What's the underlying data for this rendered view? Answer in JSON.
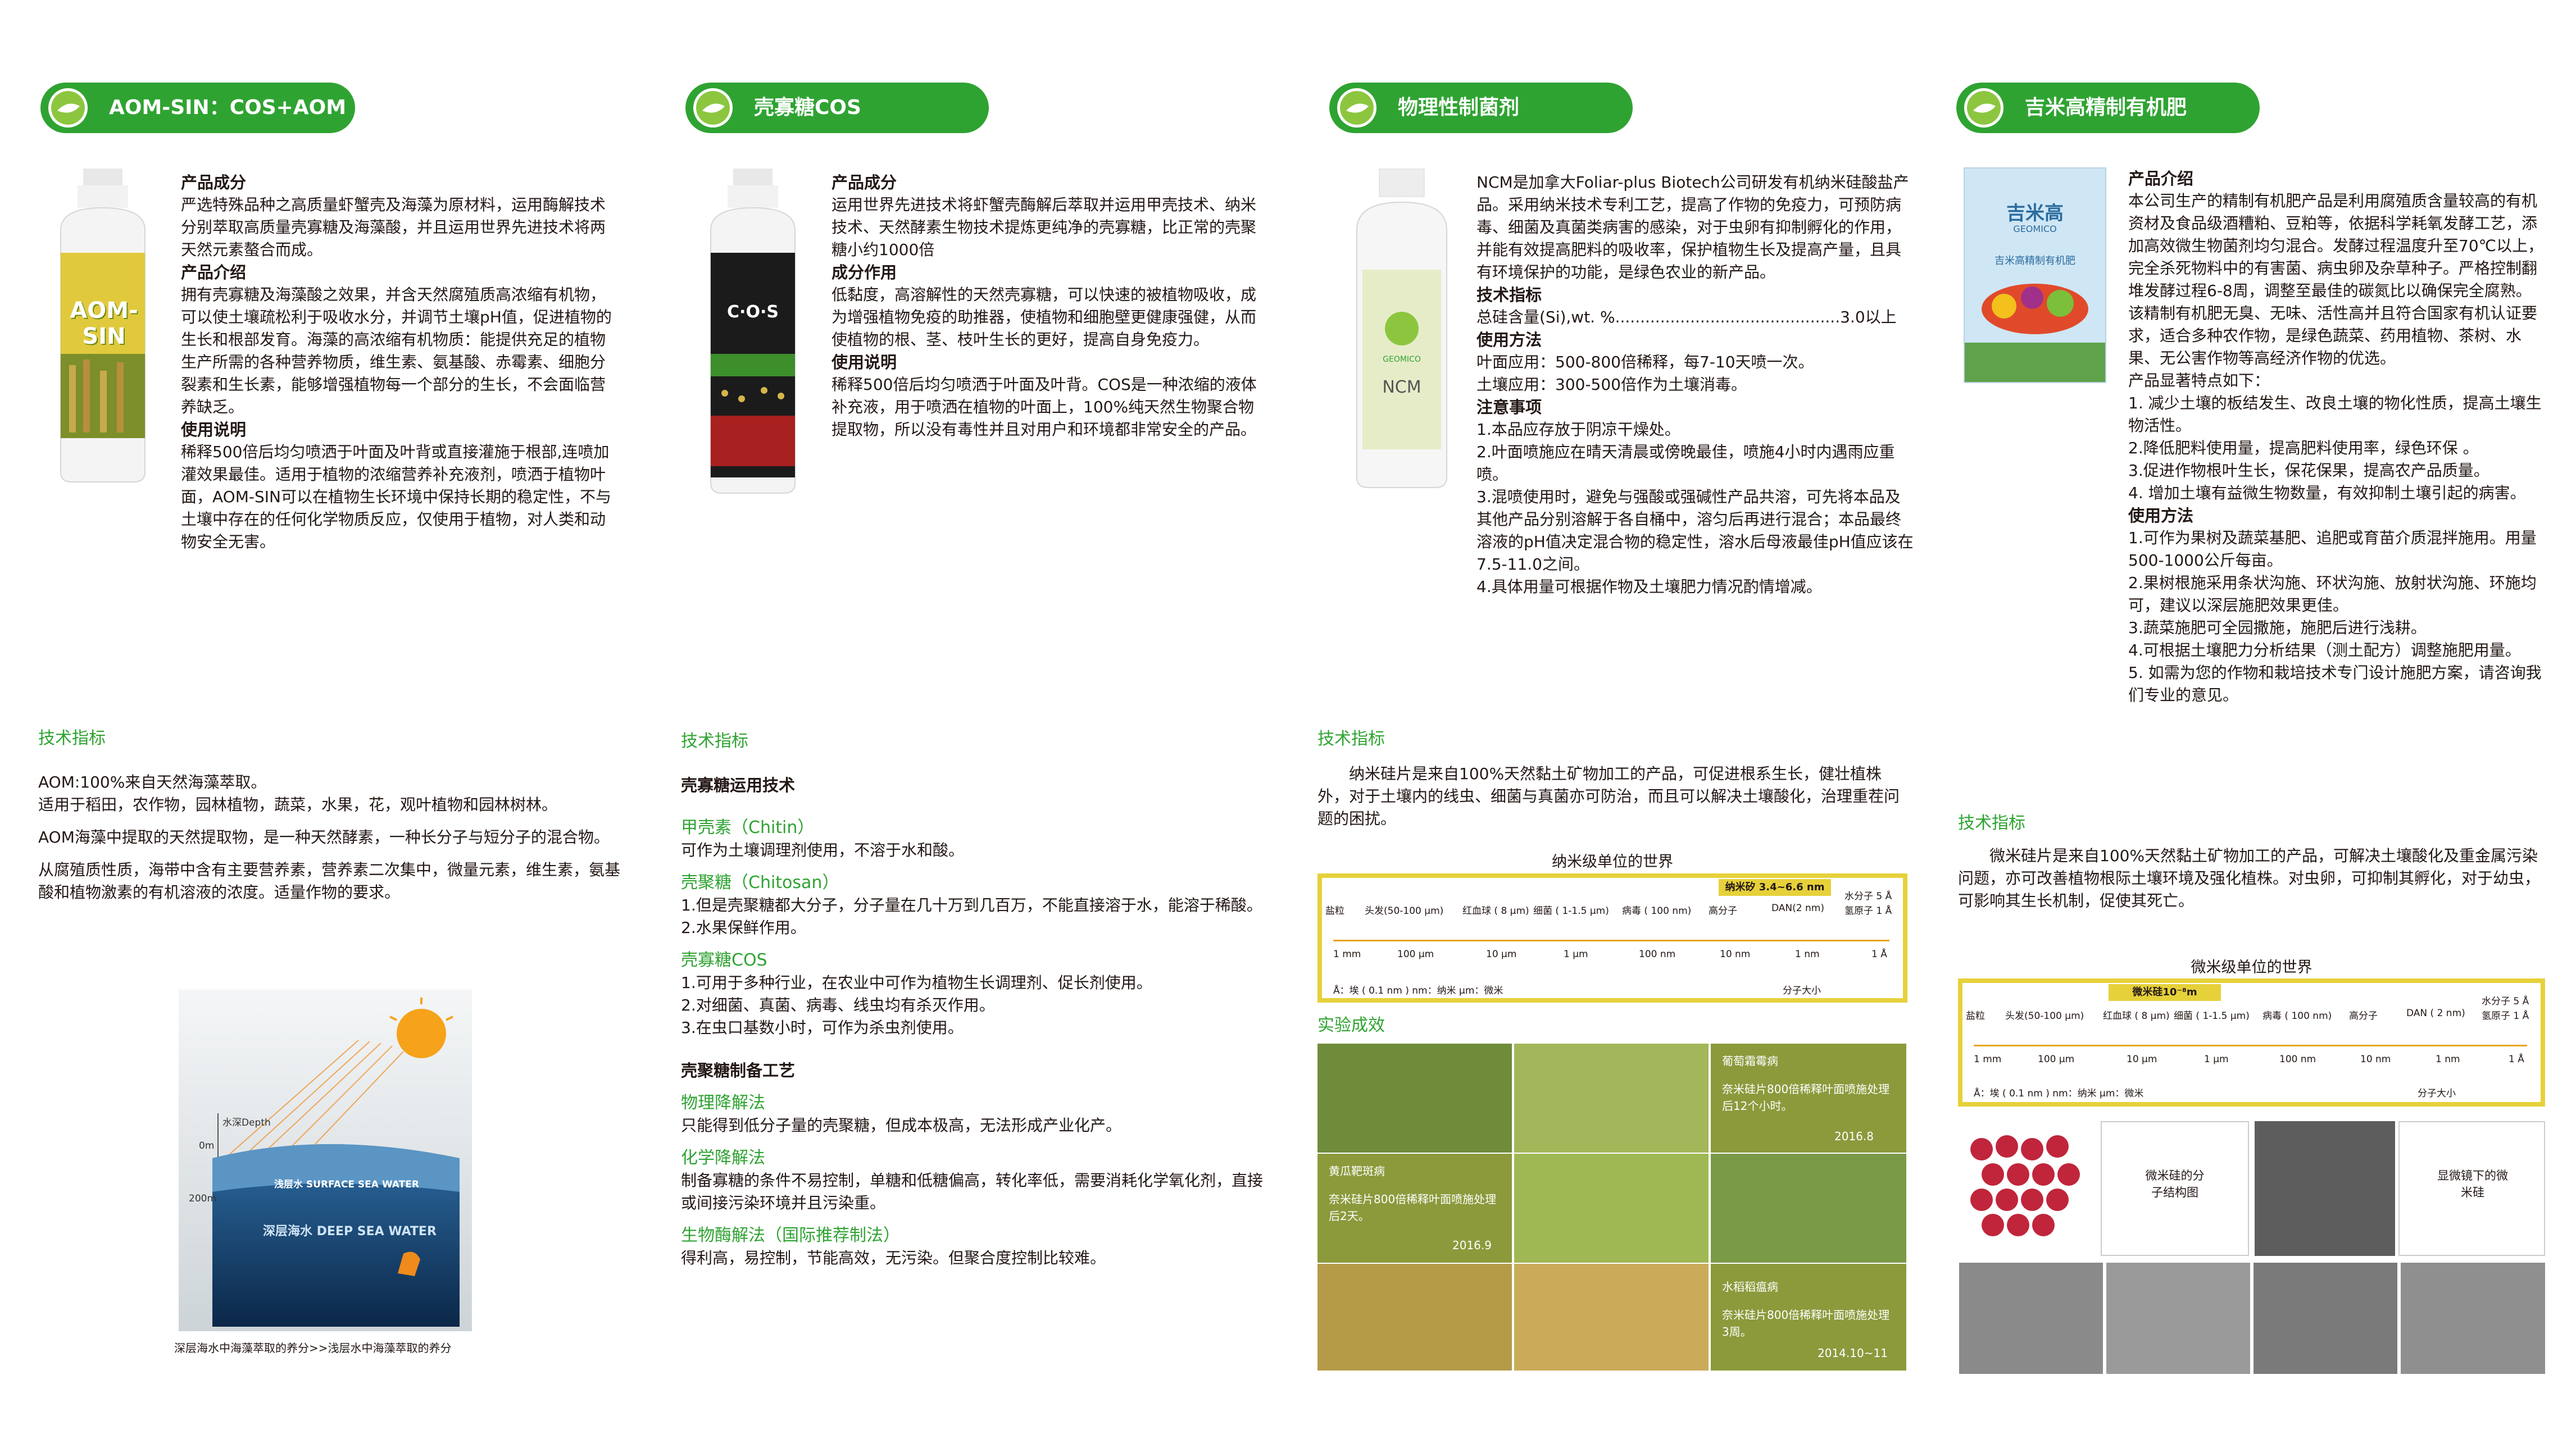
{
  "col1": {
    "pill": "AOM-SIN：COS+AOM",
    "bottle_label": "AOM-SIN",
    "h1": "产品成分",
    "p1": "严选特殊品种之高质量虾蟹壳及海藻为原材料，运用酶解技术分别萃取高质量壳寡糖及海藻酸，并且运用世界先进技术将两天然元素螯合而成。",
    "h2": "产品介绍",
    "p2": "拥有壳寡糖及海藻酸之效果，并含天然腐殖质高浓缩有机物，可以使土壤疏松利于吸收水分，并调节土壤pH值，促进植物的生长和根部发育。海藻的高浓缩有机物质：能提供充足的植物生产所需的各种营养物质，维生素、氨基酸、赤霉素、细胞分裂素和生长素，能够增强植物每一个部分的生长，不会面临营养缺乏。",
    "h3": "使用说明",
    "p3": "稀释500倍后均匀喷洒于叶面及叶背或直接灌施于根部,连喷加灌效果最佳。适用于植物的浓缩营养补充液剂，喷洒于植物叶面，AOM-SIN可以在植物生长环境中保持长期的稳定性，不与土壤中存在的任何化学物质反应，仅使用于植物，对人类和动物安全无害。",
    "spec_title": "技术指标",
    "s1": "AOM:100%来自天然海藻萃取。",
    "s2": "适用于稻田，农作物，园林植物，蔬菜，水果，花，观叶植物和园林树林。",
    "s3": "AOM海藻中提取的天然提取物，是一种天然酵素，一种长分子与短分子的混合物。",
    "s4": "从腐殖质性质，海带中含有主要营养素，营养素二次集中，微量元素，维生素，氨基酸和植物激素的有机溶液的浓度。适量作物的要求。",
    "ocean_depth": "水深Depth",
    "ocean_0m": "0m",
    "ocean_200m": "200m",
    "ocean_shallow": "浅层水  SURFACE SEA WATER",
    "ocean_deep": "深层海水  DEEP SEA WATER",
    "ocean_caption": "深层海水中海藻萃取的养分>>浅层水中海藻萃取的养分"
  },
  "col2": {
    "pill": "壳寡糖COS",
    "bottle_label": "C·O·S",
    "h1": "产品成分",
    "p1": "运用世界先进技术将虾蟹壳酶解后萃取并运用甲壳技术、纳米技术、天然酵素生物技术提炼更纯净的壳寡糖，比正常的壳聚糖小约1000倍",
    "h2": "成分作用",
    "p2": "低黏度，高溶解性的天然壳寡糖，可以快速的被植物吸收，成为增强植物免疫的助推器，使植物和细胞壁更健康强健，从而使植物的根、茎、枝叶生长的更好，提高自身免疫力。",
    "h3": "使用说明",
    "p3": "稀释500倍后均匀喷洒于叶面及叶背。COS是一种浓缩的液体补充液，用于喷洒在植物的叶面上，100%纯天然生物聚合物提取物，所以没有毒性并且对用户和环境都非常安全的产品。",
    "spec_title": "技术指标",
    "b1": "壳寡糖运用技术",
    "g1": "甲壳素（Chitin）",
    "t1": "可作为土壤调理剂使用，不溶于水和酸。",
    "g2": "壳聚糖（Chitosan）",
    "t2": "1.但是壳聚糖都大分子，分子量在几十万到几百万，不能直接溶于水，能溶于稀酸。",
    "t3": "2.水果保鲜作用。",
    "g3": "壳寡糖COS",
    "t4": "1.可用于多种行业，在农业中可作为植物生长调理剂、促长剂使用。",
    "t5": "2.对细菌、真菌、病毒、线虫均有杀灭作用。",
    "t6": "3.在虫口基数小时，可作为杀虫剂使用。",
    "b2": "壳聚糖制备工艺",
    "g4": "物理降解法",
    "t7": "只能得到低分子量的壳聚糖，但成本极高，无法形成产业化产。",
    "g5": "化学降解法",
    "t8": "制备寡糖的条件不易控制，单糖和低糖偏高，转化率低，需要消耗化学氧化剂，直接或间接污染环境并且污染重。",
    "g6": "生物酶解法（国际推荐制法）",
    "t9": "得利高，易控制，节能高效，无污染。但聚合度控制比较难。"
  },
  "col3": {
    "pill": "物理性制菌剂",
    "bottle_label": "NCM",
    "bottle_brand": "GEOMICO",
    "p0": "NCM是加拿大Foliar-plus Biotech公司研发有机纳米硅酸盐产品。采用纳米技术专利工艺，提高了作物的免疫力，可预防病毒、细菌及真菌类病害的感染，对于虫卵有抑制孵化的作用，并能有效提高肥料的吸收率，保护植物生长及提高产量，且具有环境保护的功能，是绿色农业的新产品。",
    "h1": "技术指标",
    "p1": "总硅含量(Si),wt. %.............................................3.0以上",
    "h2": "使用方法",
    "p2a": "叶面应用：500-800倍稀释，每7-10天喷一次。",
    "p2b": "土壤应用：300-500倍作为土壤消毒。",
    "h3": "注意事项",
    "n1": "1.本品应存放于阴凉干燥处。",
    "n2": "2.叶面喷施应在晴天清晨或傍晚最佳，喷施4小时内遇雨应重喷。",
    "n3": "3.混喷使用时，避免与强酸或强碱性产品共溶，可先将本品及其他产品分别溶解于各自桶中，溶匀后再进行混合；本品最终溶液的pH值决定混合物的稳定性，溶水后母液最佳pH值应该在7.5-11.0之间。",
    "n4": "4.具体用量可根据作物及土壤肥力情况酌情增减。",
    "spec_title": "技术指标",
    "spec_p": "纳米硅片是来自100%天然黏土矿物加工的产品，可促进根系生长，健壮植株外，对于土壤内的线虫、细菌与真菌亦可防治，而且可以解决土壤酸化，治理重茬问题的困扰。",
    "scale_title": "纳米级单位的世界",
    "scale_highlight": "纳米矽 3.4~6.6 nm",
    "scale_items": [
      "盐粒",
      "头发(50-100 μm)",
      "红血球 ( 8 μm)",
      "细菌 ( 1-1.5 μm)",
      "病毒 ( 100 nm)",
      "高分子",
      "DAN(2 nm)",
      "水分子 5 Å",
      "氢原子 1 Å"
    ],
    "scale_values": [
      "1 mm",
      "100 μm",
      "10 μm",
      "1 μm",
      "100 nm",
      "10 nm",
      "1 nm",
      "1 Å"
    ],
    "scale_note": "Å：埃 ( 0.1 nm )     nm：纳米     μm：微米",
    "scale_mol": "分子大小",
    "exp_title": "实验成效",
    "c1": [
      "葡萄霜霉病",
      "奈米硅片800倍稀释叶面喷施处理后12个小时。",
      "2016.8"
    ],
    "c2": [
      "黄瓜靶斑病",
      "奈米硅片800倍稀释叶面喷施处理后2天。",
      "2016.9"
    ],
    "c3": [
      "水稻稻瘟病",
      "奈米硅片800倍稀释叶面喷施处理3周。",
      "2014.10~11"
    ]
  },
  "col4": {
    "pill": "吉米高精制有机肥",
    "bag_brand": "吉米高",
    "bag_brand_en": "GEOMICO",
    "bag_sub": "吉米高精制有机肥",
    "h1": "产品介绍",
    "p1": "本公司生产的精制有机肥产品是利用腐殖质含量较高的有机资材及食品级酒糟粕、豆粕等，依据科学耗氧发酵工艺，添加高效微生物菌剂均匀混合。发酵过程温度升至70℃以上，完全杀死物料中的有害菌、病虫卵及杂草种子。严格控制翻堆发酵过程6-8周，调整至最佳的碳氮比以确保完全腐熟。该精制有机肥无臭、无味、活性高并且符合国家有机认证要求，适合多种农作物，是绿色蔬菜、药用植物、茶树、水果、无公害作物等高经济作物的优选。",
    "p2": "产品显著特点如下：",
    "f1": "1. 减少土壤的板结发生、改良土壤的物化性质，提高土壤生物活性。",
    "f2": "2.降低肥料使用量，提高肥料使用率，绿色环保 。",
    "f3": "3.促进作物根叶生长，保花保果，提高农产品质量。",
    "f4": "4. 增加土壤有益微生物数量，有效抑制土壤引起的病害。",
    "h2": "使用方法",
    "u1": "1.可作为果树及蔬菜基肥、追肥或育苗介质混拌施用。用量500-1000公斤每亩。",
    "u2": "2.果树根施采用条状沟施、环状沟施、放射状沟施、环施均可，建议以深层施肥效果更佳。",
    "u3": "3.蔬菜施肥可全园撒施，施肥后进行浅耕。",
    "u4": "4.可根据土壤肥力分析结果（测土配方）调整施肥用量。",
    "u5": "5. 如需为您的作物和栽培技术专门设计施肥方案，请咨询我们专业的意见。",
    "spec_title": "技术指标",
    "spec_p": "微米硅片是来自100%天然黏土矿物加工的产品，可解决土壤酸化及重金属污染问题，亦可改善植物根际土壤环境及强化植株。对虫卵，可抑制其孵化，对于幼虫，可影响其生长机制，促使其死亡。",
    "scale_title": "微米级单位的世界",
    "scale_highlight": "微米硅10⁻⁸m",
    "scale_items": [
      "盐粒",
      "头发(50-100 μm)",
      "红血球 ( 8 μm)",
      "细菌 ( 1-1.5 μm)",
      "病毒 ( 100 nm)",
      "高分子",
      "DAN ( 2 nm)",
      "水分子 5 Å",
      "氢原子 1 Å"
    ],
    "scale_values": [
      "1 mm",
      "100 μm",
      "10 μm",
      "1 μm",
      "100 nm",
      "10 nm",
      "1 nm",
      "1 Å"
    ],
    "scale_note": "Å：埃 ( 0.1 nm )     nm：纳米     μm：微米",
    "scale_mol": "分子大小",
    "m1": "微米硅的分子结构图",
    "m2": "显微镜下的微米硅"
  },
  "colors": {
    "green": "#2fa332",
    "yellow": "#e6d13a",
    "dark": "#231815"
  }
}
